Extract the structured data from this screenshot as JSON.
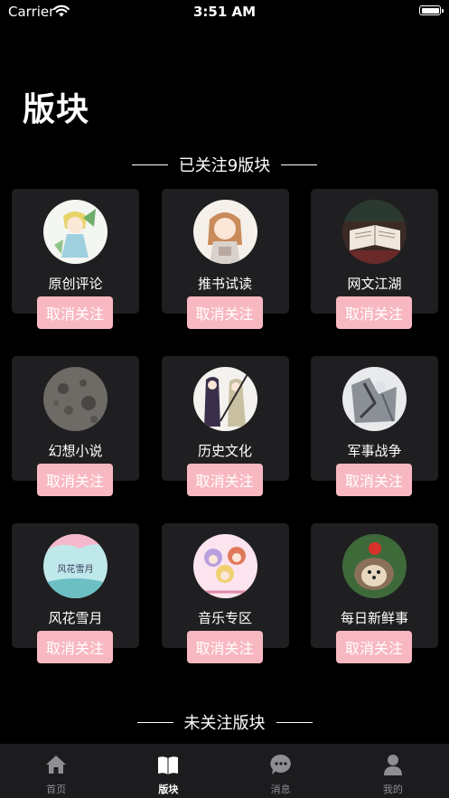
{
  "status_bar": {
    "carrier": "Carrier",
    "time": "3:51 AM"
  },
  "page_title": "版块",
  "followed_section": {
    "title": "已关注9版块"
  },
  "unfollowed_section": {
    "title": "未关注版块"
  },
  "unfollow_label": "取消关注",
  "boards": [
    {
      "name": "原创评论"
    },
    {
      "name": "推书试读"
    },
    {
      "name": "网文江湖"
    },
    {
      "name": "幻想小说"
    },
    {
      "name": "历史文化"
    },
    {
      "name": "军事战争"
    },
    {
      "name": "风花雪月"
    },
    {
      "name": "音乐专区"
    },
    {
      "name": "每日新鲜事"
    }
  ],
  "tabs": [
    {
      "label": "首页",
      "icon": "home-icon"
    },
    {
      "label": "版块",
      "icon": "book-icon",
      "active": true
    },
    {
      "label": "消息",
      "icon": "chat-bubble-icon"
    },
    {
      "label": "我的",
      "icon": "person-icon"
    }
  ],
  "colors": {
    "background": "#000000",
    "card": "#1f1f21",
    "button": "#f8b8c1",
    "tab_bar": "#1c1c1e",
    "tab_inactive": "#8e8e93"
  }
}
